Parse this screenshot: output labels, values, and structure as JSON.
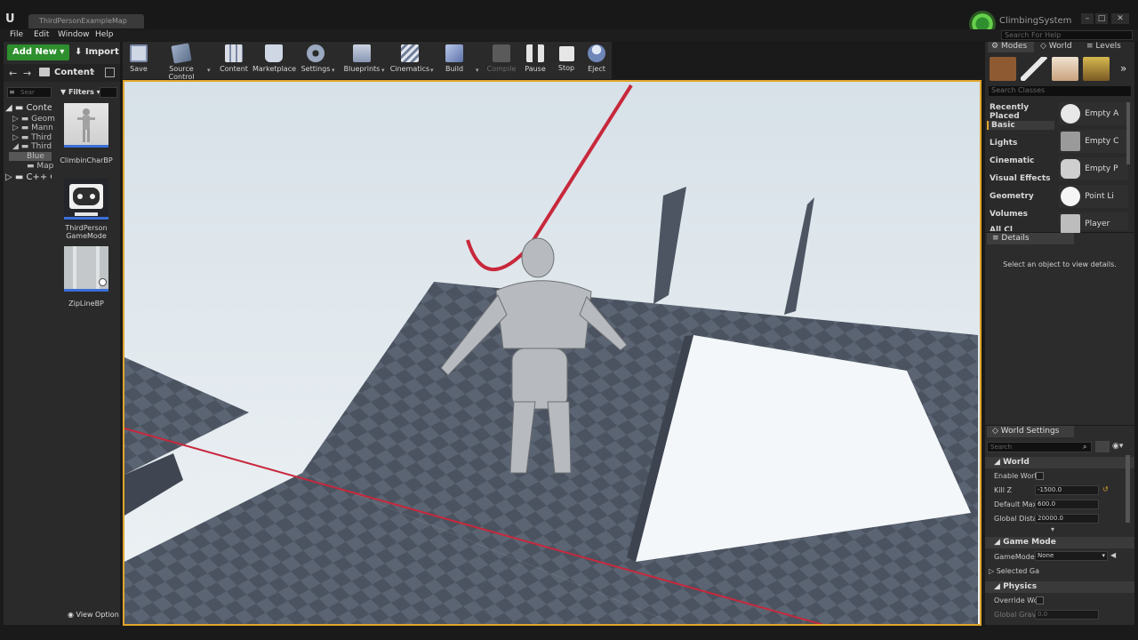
{
  "window": {
    "tab_title": "ThirdPersonExampleMap",
    "project_name": "ClimbingSystem"
  },
  "menu": [
    "File",
    "Edit",
    "Window",
    "Help"
  ],
  "search_help_placeholder": "Search For Help",
  "content_browser": {
    "add_new_label": "Add New",
    "import_label": "Import",
    "path_label": "Content",
    "filters_label": "Filters",
    "search_placeholder": "Sear",
    "tree": [
      "Conte",
      "Geom",
      "Mann",
      "Third",
      "Third",
      "Blue",
      "Map",
      "C++ C"
    ],
    "assets": [
      {
        "name": "ClimbinCharBP"
      },
      {
        "name": "ThirdPerson GameMode"
      },
      {
        "name": "ZipLineBP"
      }
    ],
    "view_options_label": "View Option"
  },
  "toolbar": [
    {
      "label": "Save",
      "icon": "save-icon"
    },
    {
      "label": "Source Control",
      "icon": "source-control-icon"
    },
    {
      "label": "Content",
      "icon": "content-icon"
    },
    {
      "label": "Marketplace",
      "icon": "marketplace-icon"
    },
    {
      "label": "Settings",
      "icon": "settings-icon"
    },
    {
      "label": "Blueprints",
      "icon": "blueprints-icon"
    },
    {
      "label": "Cinematics",
      "icon": "cinematics-icon"
    },
    {
      "label": "Build",
      "icon": "build-icon"
    },
    {
      "label": "Compile",
      "icon": "compile-icon"
    },
    {
      "label": "Pause",
      "icon": "pause-icon"
    },
    {
      "label": "Stop",
      "icon": "stop-icon"
    },
    {
      "label": "Eject",
      "icon": "eject-icon"
    }
  ],
  "modes_panel": {
    "tabs": [
      "Modes",
      "World",
      "Levels"
    ],
    "search_placeholder": "Search Classes",
    "categories": [
      "Recently Placed",
      "Basic",
      "Lights",
      "Cinematic",
      "Visual Effects",
      "Geometry",
      "Volumes",
      "All Cl"
    ],
    "placed_items": [
      "Empty A",
      "Empty C",
      "Empty P",
      "Point Li",
      "Player"
    ]
  },
  "details_panel": {
    "tab": "Details",
    "empty_message": "Select an object to view details."
  },
  "world_settings": {
    "tab": "World Settings",
    "search_placeholder": "Search",
    "sections": {
      "world": "World",
      "game_mode": "Game Mode",
      "physics": "Physics"
    },
    "fields": {
      "enable_world": "Enable World",
      "kill_z_label": "Kill Z",
      "kill_z_value": "-1500.0",
      "default_max_label": "Default Max",
      "default_max_value": "600.0",
      "global_distance_label": "Global Distar",
      "global_distance_value": "20000.0",
      "gamemode_label": "GameMode (",
      "gamemode_value": "None",
      "selected_gamemode_label": "Selected Ga",
      "override_world_label": "Override Wor",
      "global_gravity_label": "Global Gravit",
      "global_gravity_value": "0.0"
    }
  },
  "colors": {
    "accent_green": "#2d8f2d",
    "viewport_border": "#e0a52a",
    "zipline_red": "#c8283c"
  }
}
